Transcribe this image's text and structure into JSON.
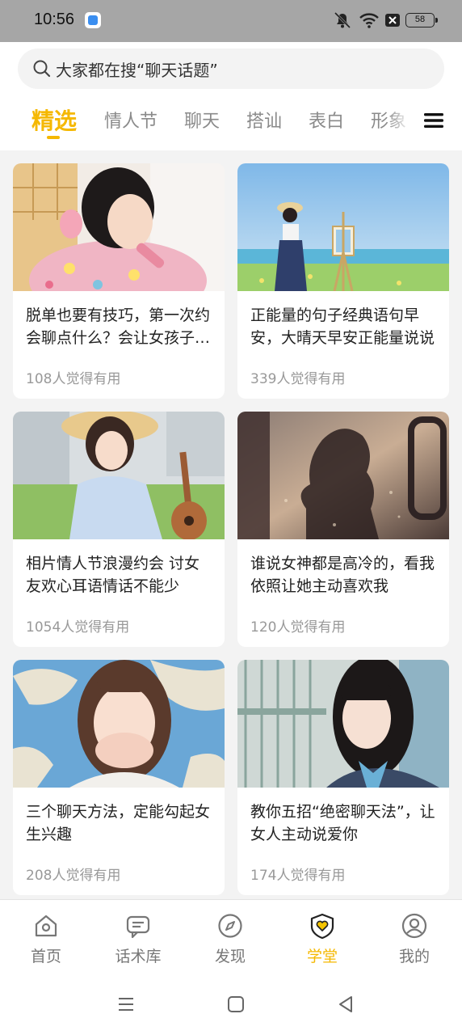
{
  "status": {
    "time": "10:56",
    "battery": "58"
  },
  "search": {
    "placeholder": "大家都在搜“聊天话题”"
  },
  "tabs": [
    {
      "label": "精选",
      "active": true
    },
    {
      "label": "情人节"
    },
    {
      "label": "聊天"
    },
    {
      "label": "搭讪"
    },
    {
      "label": "表白"
    },
    {
      "label": "形象"
    }
  ],
  "cards": [
    {
      "title": "脱单也要有技巧，第一次约会聊点什么？会让女孩子对你印象深刻",
      "meta": "108人觉得有用"
    },
    {
      "title": "正能量的句子经典语句早安，大晴天早安正能量说说",
      "meta": "339人觉得有用"
    },
    {
      "title": "相片情人节浪漫约会 讨女友欢心耳语情话不能少",
      "meta": "1054人觉得有用"
    },
    {
      "title": "谁说女神都是高冷的，看我依照让她主动喜欢我",
      "meta": "120人觉得有用"
    },
    {
      "title": "三个聊天方法，定能勾起女生兴趣",
      "meta": "208人觉得有用"
    },
    {
      "title": "教你五招“绝密聊天法”，让女人主动说爱你",
      "meta": "174人觉得有用"
    }
  ],
  "nav": [
    {
      "label": "首页",
      "icon": "home-icon"
    },
    {
      "label": "话术库",
      "icon": "chat-bubble-icon"
    },
    {
      "label": "发现",
      "icon": "compass-icon"
    },
    {
      "label": "学堂",
      "icon": "shield-heart-icon",
      "active": true
    },
    {
      "label": "我的",
      "icon": "user-icon"
    }
  ],
  "colors": {
    "accent": "#f5b800",
    "status_bar": "#a6a6a6",
    "background": "#f3f3f3"
  }
}
